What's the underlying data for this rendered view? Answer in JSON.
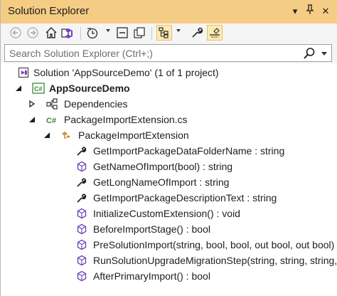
{
  "window": {
    "title": "Solution Explorer",
    "controls": {
      "dropdown": "▾",
      "pin": "🖈",
      "close": "✕"
    }
  },
  "toolbar": {
    "buttons": [
      "back",
      "forward",
      "home",
      "switch-views",
      "pending-changes-filter",
      "collapse-all",
      "show-all-files",
      "sync-with-active-document",
      "properties",
      "preview-selected-items"
    ]
  },
  "search": {
    "placeholder": "Search Solution Explorer (Ctrl+;)"
  },
  "tree": {
    "solution": "Solution 'AppSourceDemo' (1 of 1 project)",
    "project": "AppSourceDemo",
    "dependencies": "Dependencies",
    "file": "PackageImportExtension.cs",
    "class": "PackageImportExtension",
    "members": [
      {
        "label": "GetImportPackageDataFolderName : string",
        "icon": "wrench-property-icon"
      },
      {
        "label": "GetNameOfImport(bool) : string",
        "icon": "method-cube-icon"
      },
      {
        "label": "GetLongNameOfImport : string",
        "icon": "wrench-property-icon"
      },
      {
        "label": "GetImportPackageDescriptionText : string",
        "icon": "wrench-property-icon"
      },
      {
        "label": "InitializeCustomExtension() : void",
        "icon": "method-cube-icon"
      },
      {
        "label": "BeforeImportStage() : bool",
        "icon": "method-cube-icon"
      },
      {
        "label": "PreSolutionImport(string, bool, bool, out bool, out bool)",
        "icon": "method-cube-icon"
      },
      {
        "label": "RunSolutionUpgradeMigrationStep(string, string, string, Guid)",
        "icon": "method-cube-icon"
      },
      {
        "label": "AfterPrimaryImport() : bool",
        "icon": "method-cube-icon"
      }
    ]
  },
  "colors": {
    "titlebar": "#F5CC84",
    "active_tool": "#FDE9B4",
    "method_icon": "#6a3fb5",
    "csharp_green": "#388a34"
  }
}
